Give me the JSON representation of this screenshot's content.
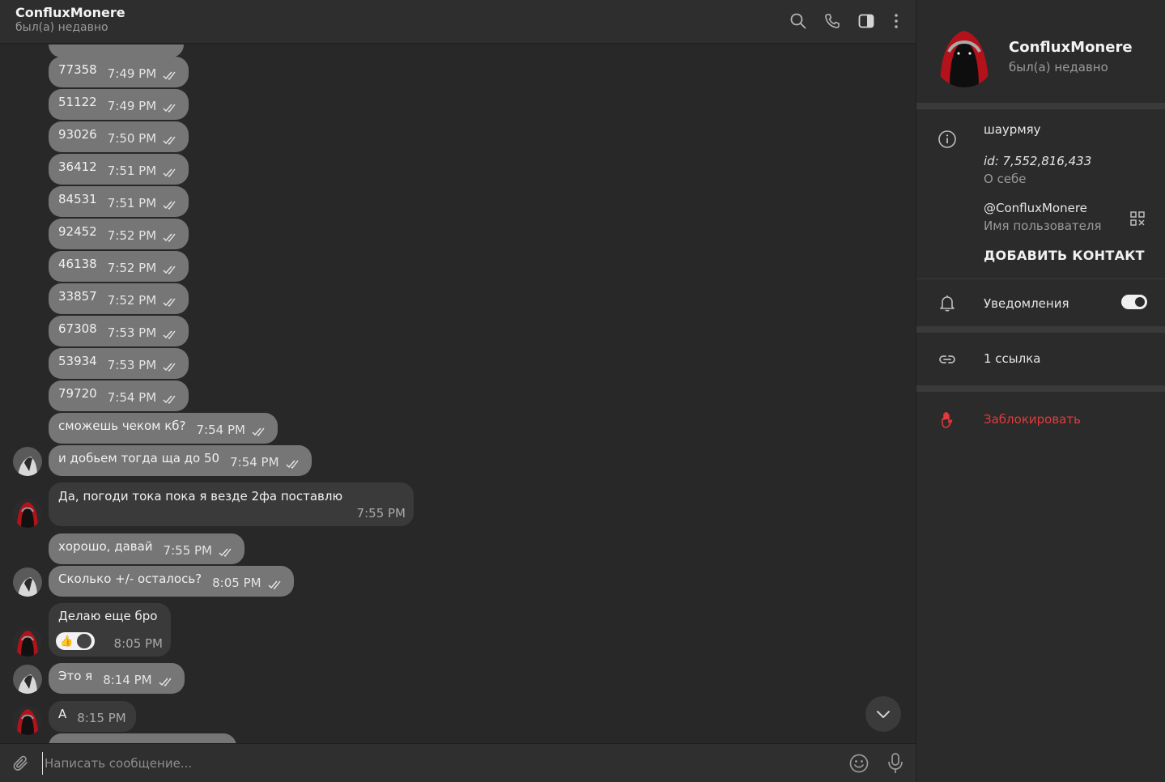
{
  "header": {
    "title": "ConfluxMonere",
    "status": "был(а) недавно"
  },
  "messages": [
    {
      "text": "77358",
      "time": "7:49 PM"
    },
    {
      "text": "51122",
      "time": "7:49 PM"
    },
    {
      "text": "93026",
      "time": "7:50 PM"
    },
    {
      "text": "36412",
      "time": "7:51 PM"
    },
    {
      "text": "84531",
      "time": "7:51 PM"
    },
    {
      "text": "92452",
      "time": "7:52 PM"
    },
    {
      "text": "46138",
      "time": "7:52 PM"
    },
    {
      "text": "33857",
      "time": "7:52 PM"
    },
    {
      "text": "67308",
      "time": "7:53 PM"
    },
    {
      "text": "53934",
      "time": "7:53 PM"
    },
    {
      "text": "79720",
      "time": "7:54 PM"
    },
    {
      "text": "сможешь чеком кб?",
      "time": "7:54 PM"
    },
    {
      "text": "и добьем тогда ща до 50",
      "time": "7:54 PM"
    },
    {
      "text": "Да, погоди тока пока я везде 2фа поставлю",
      "time": "7:55 PM"
    },
    {
      "text": "хорошо, давай",
      "time": "7:55 PM"
    },
    {
      "text": "Сколько +/- осталось?",
      "time": "8:05 PM"
    },
    {
      "text": "Делаю еще бро",
      "time": "8:05 PM"
    },
    {
      "text": "Это я",
      "time": "8:14 PM"
    },
    {
      "text": "А",
      "time": "8:15 PM"
    }
  ],
  "reaction": {
    "emoji": "👍"
  },
  "composer": {
    "placeholder": "Написать сообщение..."
  },
  "profile": {
    "name": "ConfluxMonere",
    "status": "был(а) недавно",
    "bio": "шаурмяу",
    "id": "id: 7,552,816,433",
    "bio_label": "О себе",
    "username": "@ConfluxMonere",
    "username_label": "Имя пользователя",
    "add_contact": "ДОБАВИТЬ КОНТАКТ",
    "notifications": "Уведомления",
    "notifications_on": true,
    "links": "1 ссылка",
    "block": "Заблокировать"
  },
  "colors": {
    "bubble_out": "#767676",
    "bubble_in": "#3a3a3a",
    "danger": "#e5393b",
    "avatar_red": "#b3121b"
  }
}
